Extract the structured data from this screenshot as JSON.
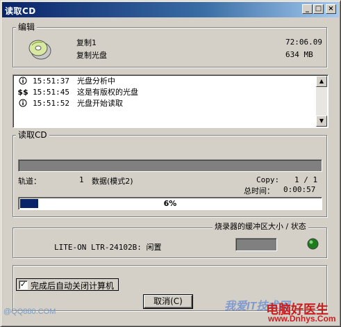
{
  "window": {
    "title": "读取CD"
  },
  "edit_group": {
    "label": "编辑",
    "copy_name": "复制1",
    "copy_type": "复制光盘",
    "duration": "72:06.09",
    "size": "634 MB"
  },
  "log": [
    {
      "icon": "info-icon",
      "time": "15:51:37",
      "msg": "光盘分析中"
    },
    {
      "icon": "copyright-icon",
      "time": "15:51:45",
      "msg": "这是有版权的光盘"
    },
    {
      "icon": "info-icon",
      "time": "15:51:52",
      "msg": "光盘开始读取"
    }
  ],
  "read_group": {
    "label": "读取CD",
    "track_label": "轨道：",
    "track_value": "1",
    "mode": "数据(模式2)",
    "copy_label": "Copy:",
    "copy_value": "1 / 1",
    "time_label": "总时间：",
    "time_value": "0:00:57",
    "progress_text": "6%",
    "progress": 0.06
  },
  "buffer_group": {
    "label": "烧录器的缓冲区大小 / 状态",
    "drive": "LITE-ON LTR-24102B: 闲置"
  },
  "options": {
    "auto_shutdown_label": "完成后自动关闭计算机",
    "auto_shutdown_checked": "✓",
    "cancel_label": "取消(C)"
  },
  "watermark": {
    "left": "@QQ880.COM",
    "brand": "电脑好医生",
    "url": "www.Dnhys.Com",
    "slogan": "我爱IT技术网"
  },
  "colors": {
    "title_start": "#0a246a",
    "progress": "#0a246a",
    "status_led": "#1e7a1e"
  }
}
